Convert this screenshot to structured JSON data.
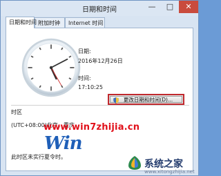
{
  "window": {
    "title": "日期和时间",
    "min_glyph": "—",
    "max_glyph": "□",
    "close_glyph": "✕"
  },
  "tabs": [
    {
      "label": "日期和时间",
      "active": true
    },
    {
      "label": "附加时钟",
      "active": false
    },
    {
      "label": "Internet 时间",
      "active": false
    }
  ],
  "clock": {
    "hour": 5,
    "minute": 10,
    "second": 25
  },
  "date": {
    "label": "日期:",
    "value": "2016年12月26日"
  },
  "time": {
    "label": "时间:",
    "value": "17:10:25"
  },
  "change_button": {
    "label": "更改日期和时间(D)..."
  },
  "timezone": {
    "label": "时区",
    "value": "(UTC+08:00)北京，重庆",
    "dst_text": "此时区未实行夏令时。"
  },
  "watermarks": {
    "site_url": "www.win7zhijia.cn",
    "win_logo": "Win",
    "brand_name": "系统之家",
    "brand_url": "www.xitongzhijia.net"
  },
  "colors": {
    "accent": "#c0282d",
    "close": "#c94b3d",
    "watermark_red": "#e1101a",
    "win_blue": "#1f5fb8"
  },
  "icons": [
    "shield-icon",
    "clock-icon"
  ]
}
